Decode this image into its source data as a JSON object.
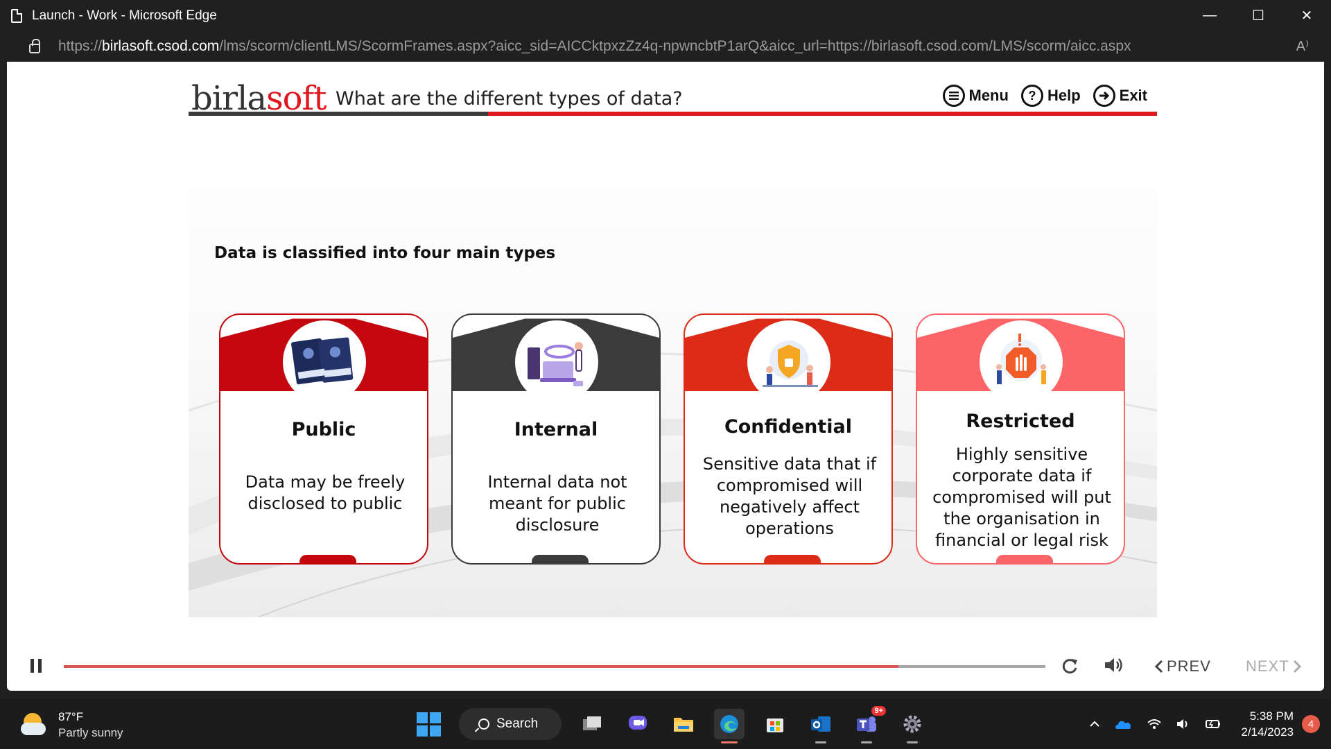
{
  "window": {
    "title": "Launch - Work - Microsoft Edge",
    "controls": {
      "minimize": "—",
      "maximize": "☐",
      "close": "✕"
    }
  },
  "address_bar": {
    "url_prefix": "https://",
    "url_host": "birlasoft.csod.com",
    "url_path": "/lms/scorm/clientLMS/ScormFrames.aspx?aicc_sid=AICCktpxzZz4q-npwncbtP1arQ&aicc_url=https://birlasoft.csod.com/LMS/scorm/aicc.aspx",
    "read_aloud_glyph": "A⁾"
  },
  "course": {
    "logo_part1": "birla",
    "logo_part2": "soft",
    "title": "What are the different types of data?",
    "nav": {
      "menu": "Menu",
      "help": "Help",
      "exit": "Exit"
    },
    "help_glyph": "?"
  },
  "slide": {
    "intro": "Data is classified into four main types",
    "cards": [
      {
        "name": "Public",
        "desc": "Data may be freely disclosed to public",
        "color": "#c4060f",
        "icon": "business-books-icon"
      },
      {
        "name": "Internal",
        "desc": "Internal data not meant for public disclosure",
        "color": "#3b3b3b",
        "icon": "data-server-icon"
      },
      {
        "name": "Confidential",
        "desc": "Sensitive data that if compromised will negatively affect operations",
        "color": "#dc2b17",
        "icon": "security-shield-icon"
      },
      {
        "name": "Restricted",
        "desc": "Highly sensitive corporate data if compromised will put the organisation in financial or legal risk",
        "color": "#fd6468",
        "icon": "stop-hand-icon"
      }
    ]
  },
  "player": {
    "progress": 0.85,
    "prev_label": "PREV",
    "next_label": "NEXT"
  },
  "taskbar": {
    "weather_temp": "87°F",
    "weather_cond": "Partly sunny",
    "search_label": "Search",
    "teams_badge": "9+",
    "time": "5:38 PM",
    "date": "2/14/2023",
    "notification_count": "4"
  }
}
